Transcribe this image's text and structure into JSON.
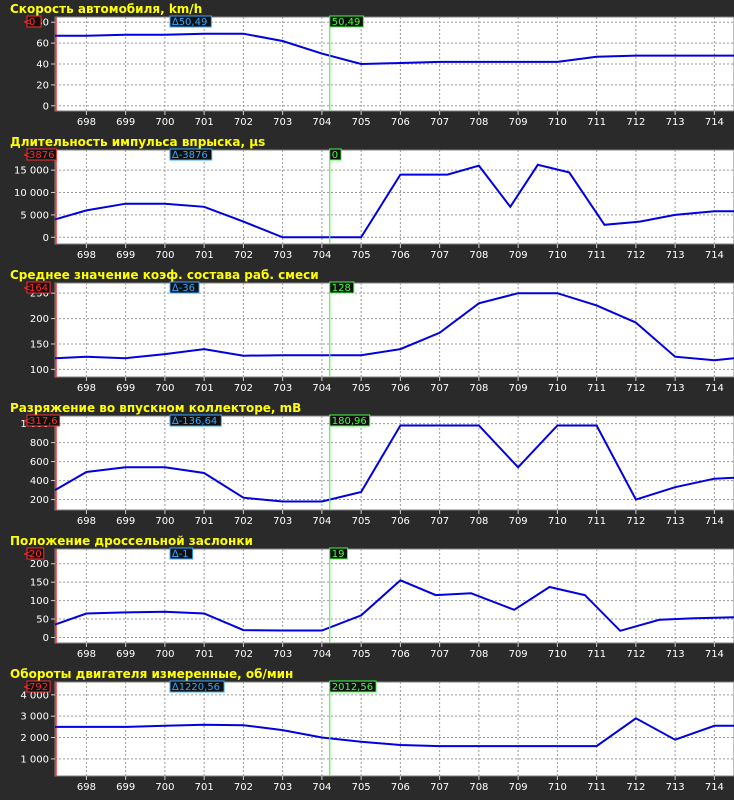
{
  "colors": {
    "background": "#2a2a2a",
    "plot_bg": "#ffffff",
    "grid": "#9a9a9a",
    "series": "#0000e0",
    "title": "#ffff00",
    "cursor_red": "#ff2a2a",
    "cursor_blue": "#2fa8ff",
    "cursor_green": "#40ff40"
  },
  "chart_data": [
    {
      "type": "line",
      "title": "Скорость автомобиля, km/h",
      "ylim": [
        -5,
        85
      ],
      "yticks": [
        0,
        20,
        40,
        60,
        80
      ],
      "ytick_labels": [
        "0",
        "20",
        "40",
        "60",
        "80"
      ],
      "xlim": [
        697.2,
        714.5
      ],
      "xticks": [
        698,
        699,
        700,
        701,
        702,
        703,
        704,
        705,
        706,
        707,
        708,
        709,
        710,
        711,
        712,
        713,
        714
      ],
      "x": [
        697.2,
        698,
        699,
        700,
        701,
        702,
        703,
        704,
        705,
        706,
        707,
        708,
        709,
        710,
        711,
        712,
        713,
        714,
        714.5
      ],
      "values": [
        67,
        67,
        68,
        68,
        69,
        69,
        62,
        50,
        40,
        41,
        42,
        42,
        42,
        42,
        47,
        48,
        48,
        48,
        48
      ],
      "grid": true,
      "cursor_x": 704.2,
      "cursor_labels": {
        "left": "0",
        "delta": "∆50,49",
        "cursor": "50,49"
      }
    },
    {
      "type": "line",
      "title": "Длительность импульса впрыска, µs",
      "ylim": [
        -1500,
        19500
      ],
      "yticks": [
        0,
        5000,
        10000,
        15000
      ],
      "ytick_labels": [
        "0",
        "5 000",
        "10 000",
        "15 000"
      ],
      "xlim": [
        697.2,
        714.5
      ],
      "xticks": [
        698,
        699,
        700,
        701,
        702,
        703,
        704,
        705,
        706,
        707,
        708,
        709,
        710,
        711,
        712,
        713,
        714
      ],
      "x": [
        697.2,
        698,
        699,
        700,
        701,
        702,
        703,
        704,
        705,
        706,
        707.2,
        708,
        708.8,
        709.5,
        710.3,
        711.2,
        712.1,
        713,
        714,
        714.5
      ],
      "values": [
        4000,
        6000,
        7500,
        7500,
        6800,
        3500,
        0,
        0,
        0,
        14000,
        14000,
        16000,
        6800,
        16200,
        14500,
        2800,
        3500,
        5000,
        5800,
        5800
      ],
      "grid": true,
      "cursor_x": 704.2,
      "cursor_labels": {
        "left": "3876",
        "delta": "∆-3876",
        "cursor": "0"
      }
    },
    {
      "type": "line",
      "title": "Среднее значение коэф. состава раб. смеси",
      "ylim": [
        85,
        270
      ],
      "yticks": [
        100,
        150,
        200,
        250
      ],
      "ytick_labels": [
        "100",
        "150",
        "200",
        "250"
      ],
      "xlim": [
        697.2,
        714.5
      ],
      "xticks": [
        698,
        699,
        700,
        701,
        702,
        703,
        704,
        705,
        706,
        707,
        708,
        709,
        710,
        711,
        712,
        713,
        714
      ],
      "x": [
        697.2,
        698,
        699,
        700,
        701,
        702,
        703,
        704,
        705,
        706,
        707,
        708,
        709,
        710,
        711,
        712,
        713,
        714,
        714.5
      ],
      "values": [
        122,
        125,
        122,
        130,
        140,
        127,
        128,
        128,
        128,
        140,
        172,
        230,
        250,
        250,
        226,
        192,
        125,
        118,
        122
      ],
      "grid": true,
      "cursor_x": 704.2,
      "cursor_labels": {
        "left": "164",
        "delta": "∆-36",
        "cursor": "128"
      }
    },
    {
      "type": "line",
      "title": "Разряжение во впускном коллекторе, mB",
      "ylim": [
        90,
        1080
      ],
      "yticks": [
        200,
        400,
        600,
        800,
        1000
      ],
      "ytick_labels": [
        "200",
        "400",
        "600",
        "800",
        "1 000"
      ],
      "xlim": [
        697.2,
        714.5
      ],
      "xticks": [
        698,
        699,
        700,
        701,
        702,
        703,
        704,
        705,
        706,
        707,
        708,
        709,
        710,
        711,
        712,
        713,
        714
      ],
      "x": [
        697.2,
        698,
        699,
        700,
        701,
        702,
        703,
        704,
        705,
        706,
        707,
        708,
        709,
        710,
        711,
        712,
        713,
        714,
        714.5
      ],
      "values": [
        300,
        490,
        540,
        540,
        480,
        220,
        180,
        180,
        280,
        980,
        980,
        980,
        540,
        980,
        980,
        200,
        330,
        420,
        430
      ],
      "grid": true,
      "cursor_x": 704.2,
      "cursor_labels": {
        "left": "317,6",
        "delta": "∆-136,64",
        "cursor": "180,96"
      }
    },
    {
      "type": "line",
      "title": "Положение дроссельной заслонки",
      "ylim": [
        -15,
        240
      ],
      "yticks": [
        0,
        50,
        100,
        150,
        200
      ],
      "ytick_labels": [
        "0",
        "50",
        "100",
        "150",
        "200"
      ],
      "xlim": [
        697.2,
        714.5
      ],
      "xticks": [
        698,
        699,
        700,
        701,
        702,
        703,
        704,
        705,
        706,
        707,
        708,
        709,
        710,
        711,
        712,
        713,
        714
      ],
      "x": [
        697.2,
        698,
        699,
        700,
        701,
        702,
        703,
        704,
        705,
        706,
        706.9,
        707.8,
        708.9,
        709.8,
        710.7,
        711.6,
        712.6,
        713.5,
        714.5
      ],
      "values": [
        35,
        65,
        68,
        70,
        65,
        20,
        19,
        19,
        60,
        155,
        115,
        120,
        75,
        137,
        115,
        18,
        48,
        52,
        55
      ],
      "grid": true,
      "cursor_x": 704.2,
      "cursor_labels": {
        "left": "20",
        "delta": "∆-1",
        "cursor": "19"
      }
    },
    {
      "type": "line",
      "title": "Обороты двигателя измеренные, об/мин",
      "ylim": [
        200,
        4600
      ],
      "yticks": [
        1000,
        2000,
        3000,
        4000
      ],
      "ytick_labels": [
        "1 000",
        "2 000",
        "3 000",
        "4 000"
      ],
      "xlim": [
        697.2,
        714.5
      ],
      "xticks": [
        698,
        699,
        700,
        701,
        702,
        703,
        704,
        705,
        706,
        707,
        708,
        709,
        710,
        711,
        712,
        713,
        714
      ],
      "x": [
        697.2,
        698,
        699,
        700,
        701,
        702,
        703,
        704,
        705,
        706,
        707,
        708,
        709,
        710,
        711,
        712,
        713,
        714,
        714.5
      ],
      "values": [
        2500,
        2500,
        2500,
        2550,
        2600,
        2580,
        2350,
        2000,
        1800,
        1650,
        1600,
        1600,
        1600,
        1600,
        1600,
        2900,
        1900,
        2550,
        2550
      ],
      "grid": true,
      "cursor_x": 704.2,
      "cursor_labels": {
        "left": "792",
        "delta": "∆1220,56",
        "cursor": "2012,56"
      }
    }
  ]
}
